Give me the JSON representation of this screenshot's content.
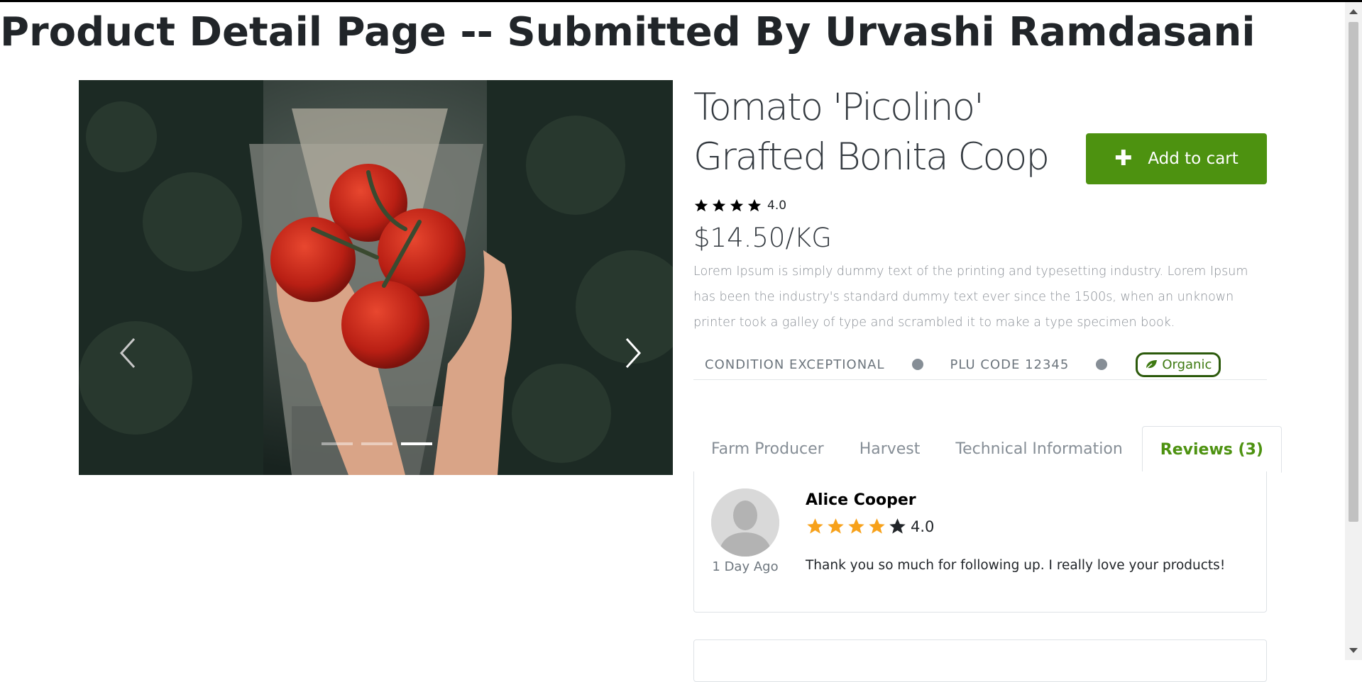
{
  "page": {
    "title": "Product Detail Page -- Submitted By Urvashi Ramdasani"
  },
  "carousel": {
    "slide_count": 3,
    "active_index": 2,
    "prev_icon": "chevron-left",
    "next_icon": "chevron-right"
  },
  "product": {
    "name": "Tomato 'Picolino' Grafted Bonita Coop",
    "rating": "4.0",
    "rating_stars": 4,
    "price": "$14.50/KG",
    "description": "Lorem Ipsum is simply dummy text of the printing and typesetting industry. Lorem Ipsum has been the industry's standard dummy text ever since the 1500s, when an unknown printer took a galley of type and scrambled it to make a type specimen book.",
    "condition": "CONDITION EXCEPTIONAL",
    "plu": "PLU CODE 12345",
    "badge": "Organic",
    "badge_icon": "leaf"
  },
  "cart": {
    "label": "Add to cart",
    "icon": "plus"
  },
  "tabs": [
    {
      "label": "Farm Producer"
    },
    {
      "label": "Harvest"
    },
    {
      "label": "Technical Information"
    },
    {
      "label": "Reviews (3)"
    }
  ],
  "reviews": [
    {
      "name": "Alice Cooper",
      "rating": "4.0",
      "stars": 4,
      "time": "1 Day Ago",
      "text": "Thank you so much for following up. I really love your products!"
    }
  ],
  "colors": {
    "accent": "#4d9210",
    "star_review": "#f7a11a",
    "text_dark": "#212529"
  }
}
